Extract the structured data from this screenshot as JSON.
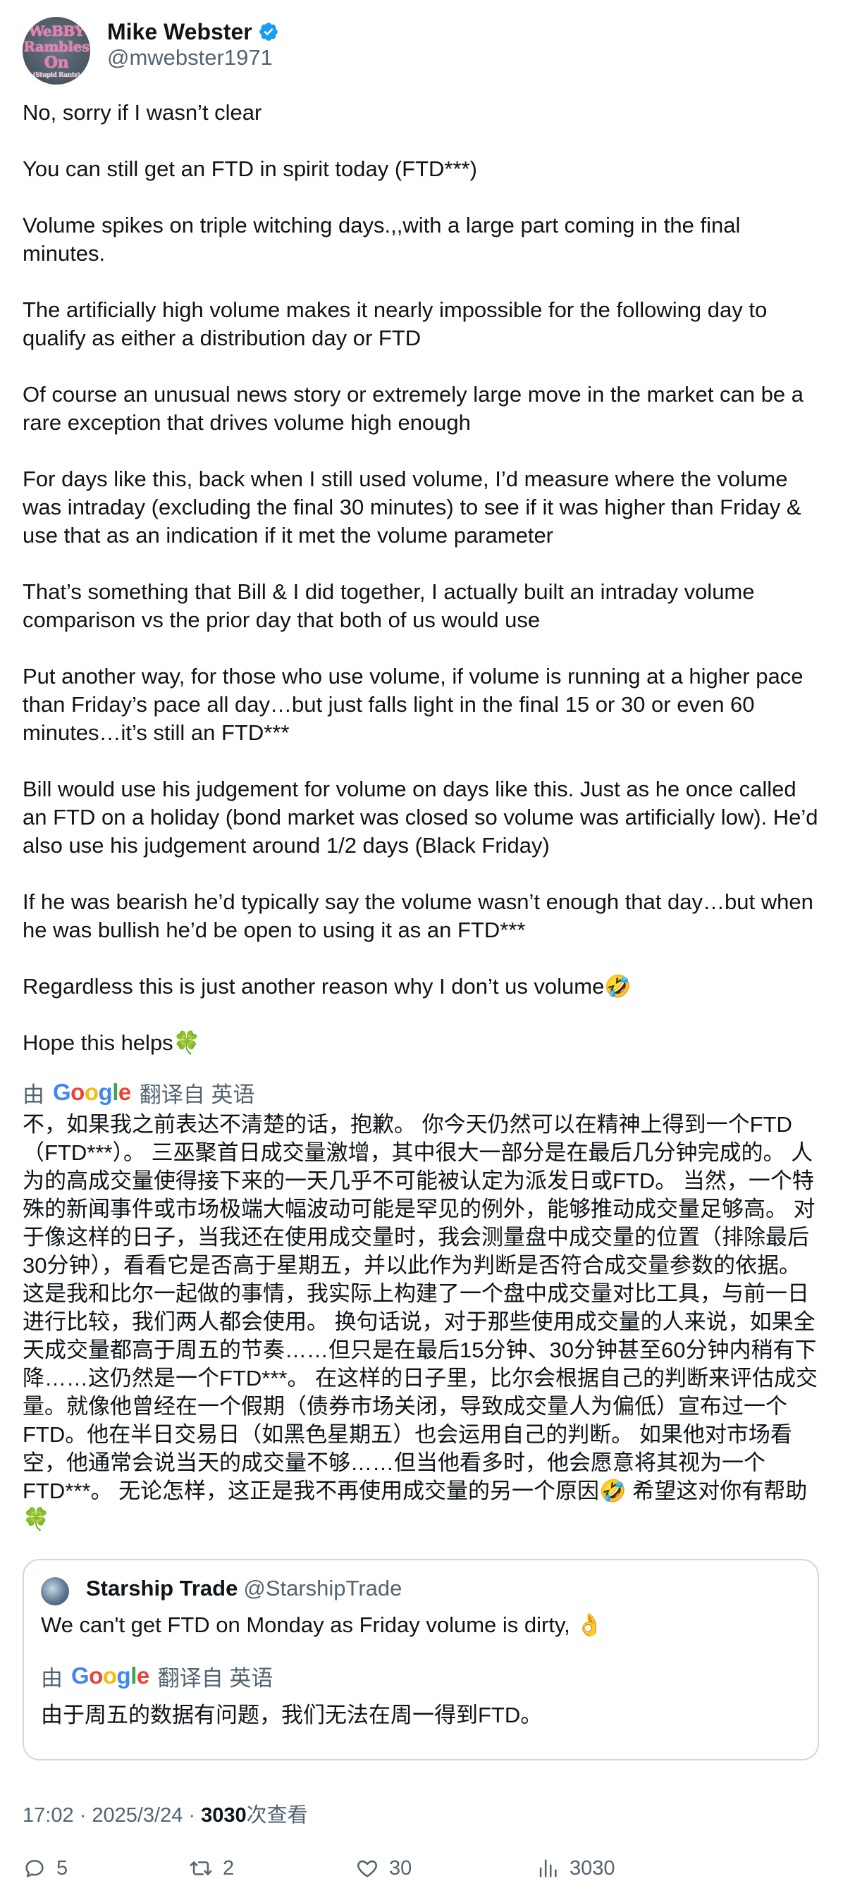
{
  "author": {
    "name": "Mike Webster",
    "handle": "@mwebster1971",
    "avatar_text": [
      "WeBBY",
      "Rambles",
      "On",
      "(Stupid Rants)"
    ]
  },
  "tweet": {
    "paragraphs": [
      "No, sorry if I wasn’t clear",
      "You can still get an FTD in spirit today (FTD***)",
      "Volume spikes on triple witching days.,,with a large part coming in the final minutes.",
      "The artificially high volume makes it nearly impossible for the following day to qualify as either a distribution day or FTD",
      "Of course an unusual news story or extremely large move in the market can be a rare exception that drives volume high enough",
      "For days like this, back when I still used volume, I’d measure where the volume was intraday (excluding the final 30 minutes) to see if it was higher than Friday & use that as an indication if it met the volume parameter",
      "That’s something that Bill & I did together, I actually built an intraday volume comparison vs the prior day that both of us would use",
      "Put another way, for those who use volume, if volume is running at a higher pace than Friday’s pace all day…but just falls light in the final 15 or 30 or even 60 minutes…it’s still an FTD***",
      "Bill would use his judgement for volume on days like this. Just as he once called an FTD on a holiday (bond market was closed so volume was artificially low). He’d also use his judgement around 1/2 days (Black Friday)",
      "If he was bearish he’d typically say the volume wasn’t enough that day…but when he was bullish he’d be open to using it as an FTD***",
      "Regardless this is just another reason why I don’t us volume🤣",
      "Hope this helps🍀"
    ],
    "translate_prefix": "由",
    "translate_brand": "Google",
    "translate_suffix": "翻译自 英语",
    "translation": "不，如果我之前表达不清楚的话，抱歉。 你今天仍然可以在精神上得到一个FTD（FTD***）。 三巫聚首日成交量激增，其中很大一部分是在最后几分钟完成的。 人为的高成交量使得接下来的一天几乎不可能被认定为派发日或FTD。 当然，一个特殊的新闻事件或市场极端大幅波动可能是罕见的例外，能够推动成交量足够高。 对于像这样的日子，当我还在使用成交量时，我会测量盘中成交量的位置（排除最后30分钟），看看它是否高于星期五，并以此作为判断是否符合成交量参数的依据。 这是我和比尔一起做的事情，我实际上构建了一个盘中成交量对比工具，与前一日进行比较，我们两人都会使用。 换句话说，对于那些使用成交量的人来说，如果全天成交量都高于周五的节奏……但只是在最后15分钟、30分钟甚至60分钟内稍有下降……这仍然是一个FTD***。 在这样的日子里，比尔会根据自己的判断来评估成交量。就像他曾经在一个假期（债券市场关闭，导致成交量人为偏低）宣布过一个FTD。他在半日交易日（如黑色星期五）也会运用自己的判断。 如果他对市场看空，他通常会说当天的成交量不够……但当他看多时，他会愿意将其视为一个FTD***。 无论怎样，这正是我不再使用成交量的另一个原因🤣 希望这对你有帮助🍀"
  },
  "quote": {
    "name": "Starship Trade",
    "handle": "@StarshipTrade",
    "text": "We can't get FTD on Monday as Friday volume is dirty, 👌",
    "translate_prefix": "由",
    "translate_brand": "Google",
    "translate_suffix": "翻译自 英语",
    "translation": "由于周五的数据有问题，我们无法在周一得到FTD。"
  },
  "meta": {
    "time": "17:02",
    "separator": " · ",
    "date": "2025/3/24",
    "views_count": "3030",
    "views_label": "次查看"
  },
  "actions": {
    "replies": "5",
    "retweets": "2",
    "likes": "30",
    "views": "3030"
  },
  "colors": {
    "text": "#0f1419",
    "secondary": "#536471",
    "verified": "#1d9bf0",
    "border": "#cfd9de"
  }
}
